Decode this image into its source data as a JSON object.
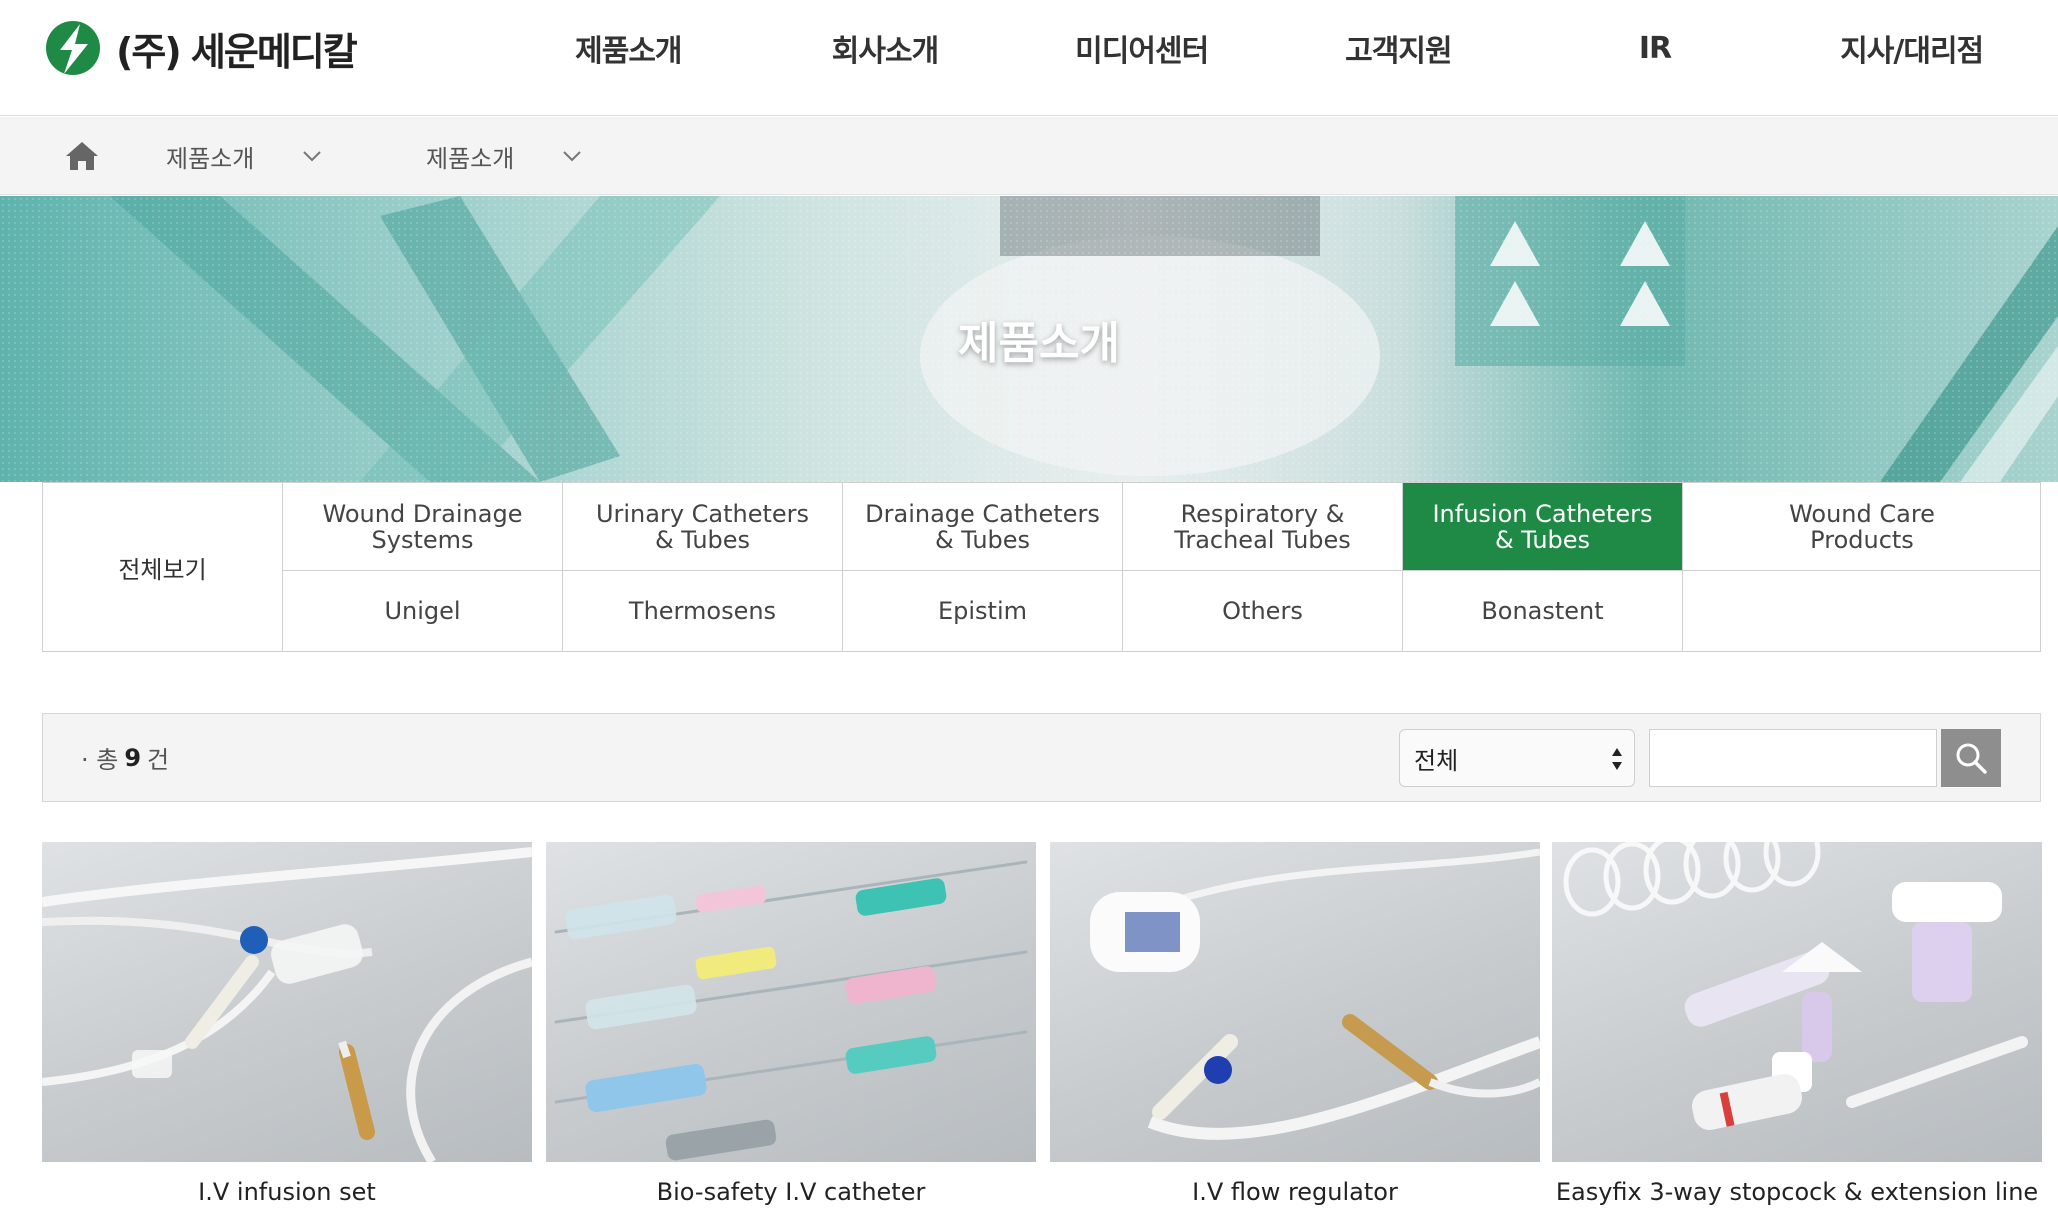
{
  "header": {
    "logo_text": "(주) 세운메디칼",
    "nav": [
      "제품소개",
      "회사소개",
      "미디어센터",
      "고객지원",
      "IR",
      "지사/대리점"
    ]
  },
  "breadcrumb": {
    "items": [
      "제품소개",
      "제품소개"
    ]
  },
  "banner": {
    "title": "제품소개"
  },
  "categories": {
    "all_label": "전체보기",
    "row1": [
      "Wound Drainage\nSystems",
      "Urinary Catheters\n& Tubes",
      "Drainage Catheters\n& Tubes",
      "Respiratory &\nTracheal Tubes",
      "Infusion Catheters\n& Tubes",
      "Wound Care\nProducts"
    ],
    "row2": [
      "Unigel",
      "Thermosens",
      "Epistim",
      "Others",
      "Bonastent",
      ""
    ],
    "active_index": 4,
    "active_color": "#1f8a45"
  },
  "search": {
    "count_prefix": "· 총",
    "count_value": "9",
    "count_suffix": "건",
    "select_value": "전체",
    "input_value": ""
  },
  "products": [
    {
      "name": "I.V infusion set"
    },
    {
      "name": "Bio-safety I.V catheter"
    },
    {
      "name": "I.V flow regulator"
    },
    {
      "name": "Easyfix 3-way stopcock & extension line"
    }
  ]
}
